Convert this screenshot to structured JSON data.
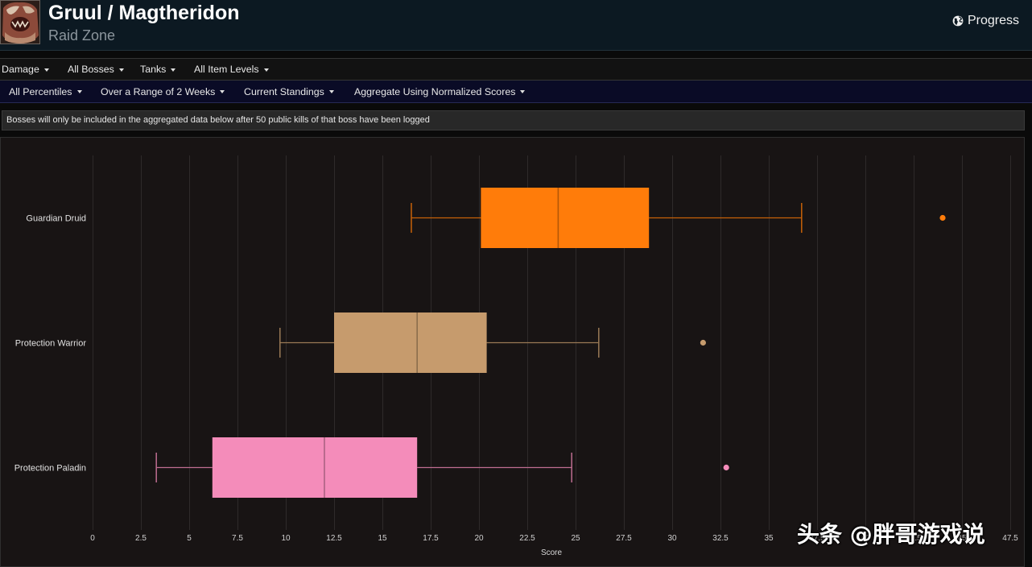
{
  "header": {
    "title": "Gruul / Magtheridon",
    "subtitle": "Raid Zone",
    "progress_label": "Progress",
    "progress_icon": "globe-icon"
  },
  "menus": {
    "dropdown_icon": "caret-down-icon",
    "row1": [
      {
        "label": "Damage"
      },
      {
        "label": "All Bosses"
      },
      {
        "label": "Tanks"
      },
      {
        "label": "All Item Levels"
      }
    ],
    "row2": [
      {
        "label": "All Percentiles"
      },
      {
        "label": "Over a Range of 2 Weeks"
      },
      {
        "label": "Current Standings"
      },
      {
        "label": "Aggregate Using Normalized Scores"
      }
    ]
  },
  "notice": {
    "text": "Bosses will only be included in the aggregated data below after 50 public kills of that boss have been logged"
  },
  "chart_data": {
    "type": "box",
    "orientation": "horizontal",
    "xlabel": "Score",
    "ylabel": "",
    "xlim": [
      0,
      47.5
    ],
    "x_ticks": [
      0,
      2.5,
      5,
      7.5,
      10,
      12.5,
      15,
      17.5,
      20,
      22.5,
      25,
      27.5,
      30,
      32.5,
      35,
      37.5,
      40,
      42.5,
      45,
      47.5
    ],
    "grid": true,
    "series": [
      {
        "name": "Guardian Druid",
        "color": "#ff7c0a",
        "min": 16.5,
        "q1": 20.1,
        "median": 24.1,
        "q3": 28.8,
        "max": 36.7,
        "outliers": [
          44.0
        ]
      },
      {
        "name": "Protection Warrior",
        "color": "#c69b6d",
        "min": 9.7,
        "q1": 12.5,
        "median": 16.8,
        "q3": 20.4,
        "max": 26.2,
        "outliers": [
          31.6
        ]
      },
      {
        "name": "Protection Paladin",
        "color": "#f48cba",
        "min": 3.3,
        "q1": 6.2,
        "median": 12.0,
        "q3": 16.8,
        "max": 24.8,
        "outliers": [
          32.8
        ]
      }
    ]
  },
  "watermark": {
    "text": "头条 @胖哥游戏说"
  }
}
